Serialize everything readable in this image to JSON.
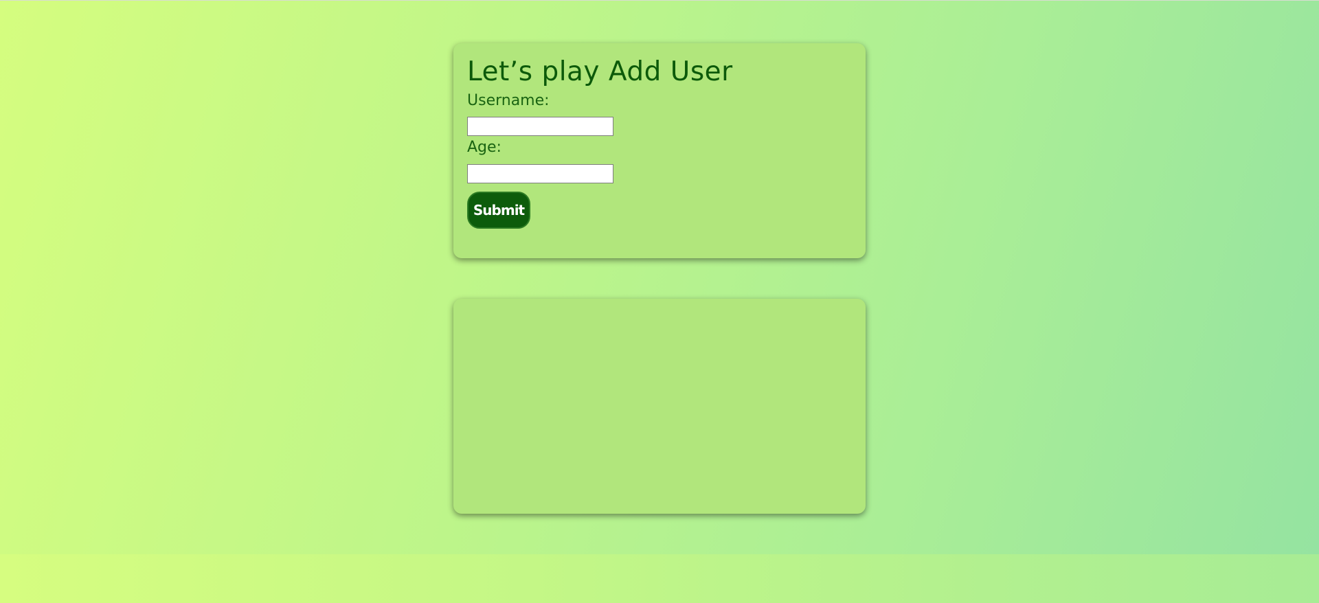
{
  "form": {
    "title": "Let’s play Add User",
    "username_label": "Username:",
    "username_value": "",
    "age_label": "Age:",
    "age_value": "",
    "submit_label": "Submit"
  },
  "colors": {
    "card": "#b1e67c",
    "text": "#0c5a0a",
    "button": "#0d5c0b",
    "gradient_start": "#d5fd7f",
    "gradient_end": "#95e3a1"
  }
}
